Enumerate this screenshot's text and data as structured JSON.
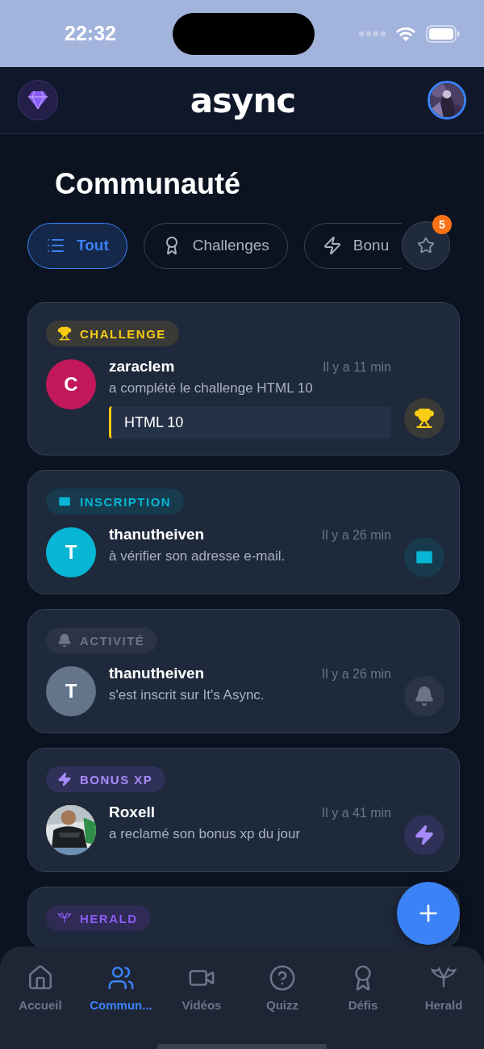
{
  "status_bar": {
    "time": "22:32"
  },
  "header": {
    "logo": "async"
  },
  "page_title": "Communauté",
  "filters": [
    {
      "label": "Tout",
      "kind": "list",
      "selected": true
    },
    {
      "label": "Challenges",
      "kind": "award",
      "selected": false
    },
    {
      "label": "Bonu",
      "kind": "zap",
      "selected": false
    }
  ],
  "favorites": {
    "badge": "5"
  },
  "feed": [
    {
      "kind": "challenge",
      "tag": "CHALLENGE",
      "avatar": {
        "kind": "letter",
        "letter": "C",
        "color": "#c2185b"
      },
      "user": "zaraclem",
      "time": "Il y a 11 min",
      "text": "a complété le challenge HTML 10",
      "highlight": "HTML 10"
    },
    {
      "kind": "inscription",
      "tag": "INSCRIPTION",
      "avatar": {
        "kind": "letter",
        "letter": "T",
        "color": "#06b6d4"
      },
      "user": "thanutheiven",
      "time": "Il y a 26 min",
      "text": "à vérifier son adresse e-mail."
    },
    {
      "kind": "activity",
      "tag": "ACTIVITÉ",
      "avatar": {
        "kind": "letter",
        "letter": "T",
        "color": "#64748b"
      },
      "user": "thanutheiven",
      "time": "Il y a 26 min",
      "text": "s'est inscrit sur It's Async."
    },
    {
      "kind": "bonus",
      "tag": "BONUS XP",
      "user": "Roxell",
      "time": "Il y a 41 min",
      "text": "a reclamé son bonus xp du jour"
    },
    {
      "kind": "herald",
      "tag": "HERALD"
    }
  ],
  "nav": [
    {
      "label": "Accueil",
      "kind": "home",
      "selected": false
    },
    {
      "label": "Commun...",
      "kind": "users",
      "selected": true
    },
    {
      "label": "Vidéos",
      "kind": "video",
      "selected": false
    },
    {
      "label": "Quizz",
      "kind": "quiz",
      "selected": false
    },
    {
      "label": "Défis",
      "kind": "award",
      "selected": false
    },
    {
      "label": "Herald",
      "kind": "herald",
      "selected": false
    }
  ]
}
